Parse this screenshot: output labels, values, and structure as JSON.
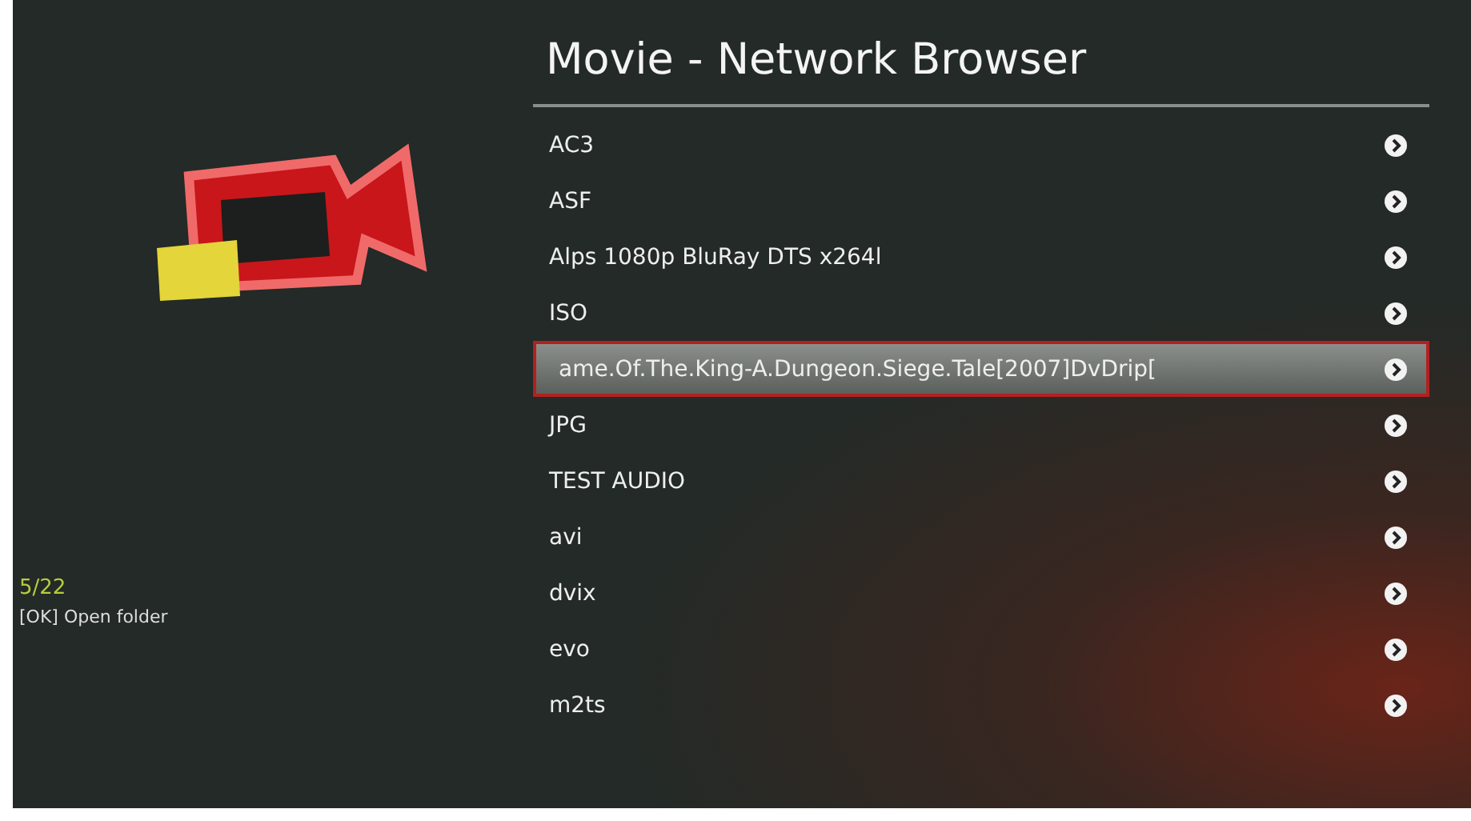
{
  "header": {
    "title": "Movie  - Network Browser"
  },
  "info": {
    "position": "5/22",
    "hint": "[OK] Open folder"
  },
  "items": [
    {
      "name": "AC3",
      "selected": false
    },
    {
      "name": "ASF",
      "selected": false
    },
    {
      "name": "Alps 1080p BluRay DTS x264l",
      "selected": false
    },
    {
      "name": "ISO",
      "selected": false
    },
    {
      "name": "ame.Of.The.King-A.Dungeon.Siege.Tale[2007]DvDrip[",
      "selected": true
    },
    {
      "name": "JPG",
      "selected": false
    },
    {
      "name": "TEST AUDIO",
      "selected": false
    },
    {
      "name": "avi",
      "selected": false
    },
    {
      "name": "dvix",
      "selected": false
    },
    {
      "name": "evo",
      "selected": false
    },
    {
      "name": "m2ts",
      "selected": false
    }
  ]
}
